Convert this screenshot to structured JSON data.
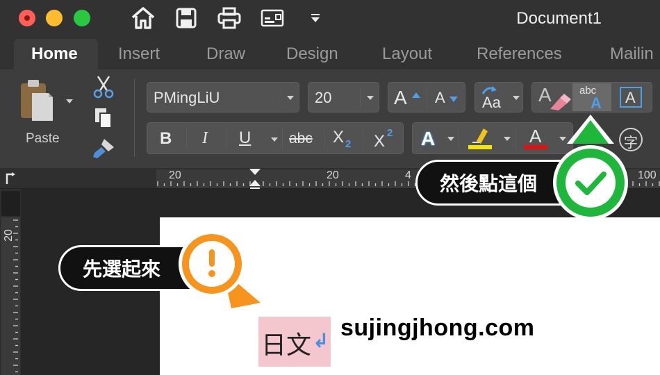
{
  "window": {
    "title": "Document1"
  },
  "tabs": [
    {
      "label": "Home",
      "active": true
    },
    {
      "label": "Insert",
      "active": false
    },
    {
      "label": "Draw",
      "active": false
    },
    {
      "label": "Design",
      "active": false
    },
    {
      "label": "Layout",
      "active": false
    },
    {
      "label": "References",
      "active": false
    },
    {
      "label": "Mailin",
      "active": false
    }
  ],
  "ribbon": {
    "paste_label": "Paste",
    "font_name": "PMingLiU",
    "font_size": "20",
    "bold": "B",
    "italic": "I",
    "underline": "U",
    "strikethrough": "abc",
    "subscript": "X",
    "subscript_mark": "2",
    "superscript": "X",
    "superscript_mark": "2",
    "grow_font": "A",
    "shrink_font": "A",
    "change_case": "Aa",
    "phonetic_guide_top": "abc",
    "phonetic_guide_bottom": "A",
    "character_border": "A",
    "text_effects": "A",
    "font_color": "A",
    "enclose_characters": "字",
    "highlight_color": "#f5e30c",
    "font_color_value": "#e01212"
  },
  "ruler": {
    "top_numbers": [
      "20",
      "20",
      "4",
      "100"
    ],
    "left_numbers": [
      "20"
    ]
  },
  "document": {
    "selected_text": "日文",
    "paragraph_mark": "↲",
    "watermark": "sujingjhong.com"
  },
  "callouts": {
    "first": "先選起來",
    "second": "然後點這個",
    "orange": "#f7941d",
    "green": "#1fb73b"
  }
}
